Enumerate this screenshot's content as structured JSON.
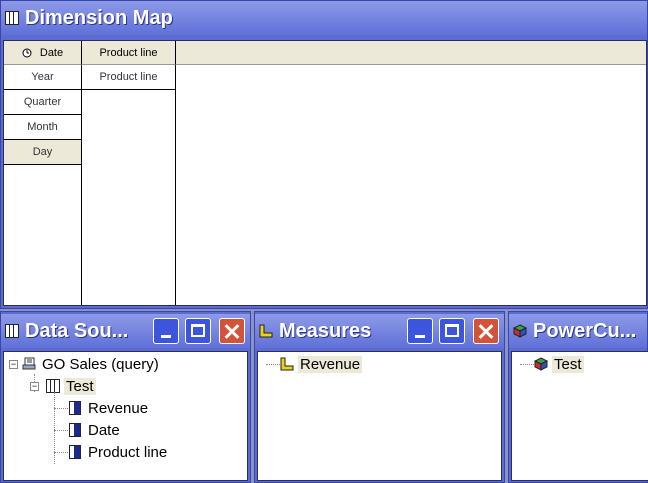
{
  "dimension_map": {
    "title": "Dimension Map",
    "columns": [
      {
        "header": "Date",
        "cells": [
          "Year",
          "Quarter",
          "Month",
          "Day"
        ],
        "selected": "Day"
      },
      {
        "header": "Product line",
        "cells": [
          "Product line"
        ]
      }
    ]
  },
  "data_source": {
    "title": "Data Sou...",
    "tree": {
      "root": "GO Sales (query)",
      "child": "Test",
      "leaves": [
        "Revenue",
        "Date",
        "Product line"
      ]
    }
  },
  "measures": {
    "title": "Measures",
    "items": [
      "Revenue"
    ]
  },
  "powercube": {
    "title": "PowerCu...",
    "items": [
      "Test"
    ]
  }
}
